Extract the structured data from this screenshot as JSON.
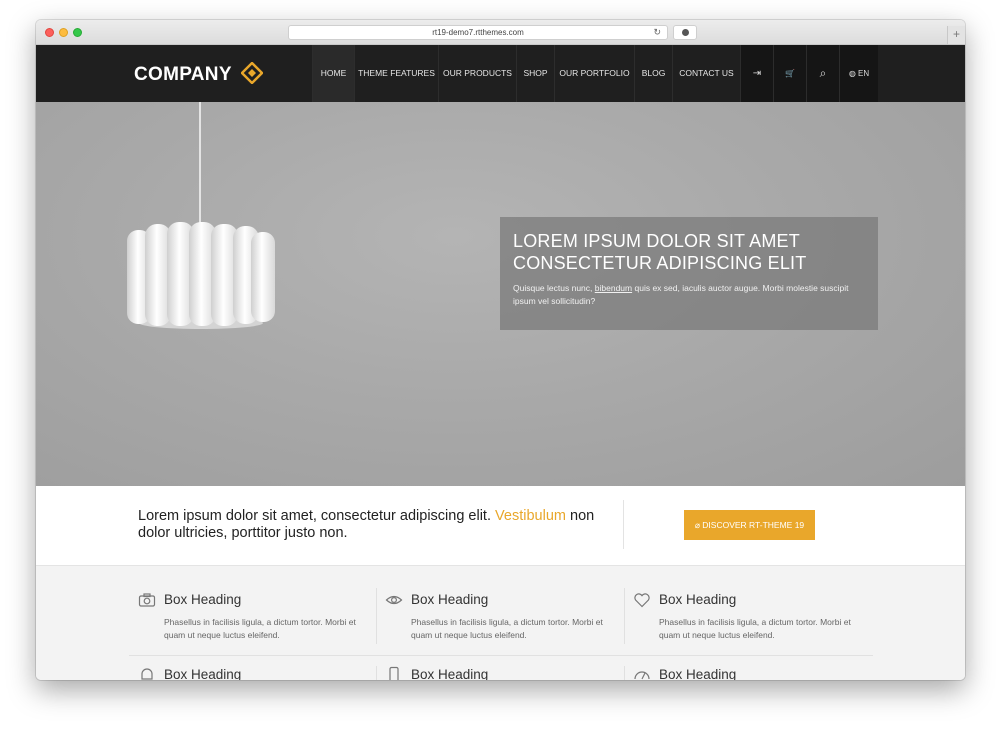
{
  "browser": {
    "url": "rt19-demo7.rtthemes.com",
    "reload_glyph": "↻",
    "newtab_glyph": "+"
  },
  "site": {
    "logo_text": "COMPANY",
    "accent_color": "#e9a72b",
    "nav": [
      {
        "label": "HOME",
        "active": true
      },
      {
        "label": "THEME FEATURES"
      },
      {
        "label": "OUR PRODUCTS"
      },
      {
        "label": "SHOP"
      },
      {
        "label": "OUR PORTFOLIO"
      },
      {
        "label": "BLOG"
      },
      {
        "label": "CONTACT US"
      }
    ],
    "nav_icons": [
      {
        "icon": "login-icon",
        "glyph": "⇥"
      },
      {
        "icon": "cart-icon",
        "glyph": "🛒"
      },
      {
        "icon": "search-icon",
        "glyph": "⌕"
      },
      {
        "icon": "globe-icon",
        "glyph": "◍",
        "label": "EN"
      }
    ]
  },
  "hero": {
    "title_line1": "LOREM IPSUM DOLOR SIT AMET",
    "title_line2": "CONSECTETUR ADIPISCING ELIT",
    "text_before": "Quisque lectus nunc,",
    "text_link": "bibendum",
    "text_after": "quis ex sed, iaculis auctor augue. Morbi molestie suscipit ipsum vel sollicitudin?"
  },
  "cta": {
    "text_main": "Lorem ipsum dolor sit amet, consectetur adipiscing elit.",
    "text_accent": "Vestibulum",
    "text_end": "non dolor ultricies, porttitor justo non.",
    "button_label": "DISCOVER RT-THEME 19"
  },
  "features": [
    {
      "icon": "camera-icon",
      "title": "Box Heading",
      "text": "Phasellus in facilisis ligula, a dictum tortor. Morbi et quam ut neque luctus eleifend."
    },
    {
      "icon": "eye-icon",
      "title": "Box Heading",
      "text": "Phasellus in facilisis ligula, a dictum tortor. Morbi et quam ut neque luctus eleifend."
    },
    {
      "icon": "heart-icon",
      "title": "Box Heading",
      "text": "Phasellus in facilisis ligula, a dictum tortor. Morbi et quam ut neque luctus eleifend."
    },
    {
      "icon": "bell-icon",
      "title": "Box Heading",
      "text": ""
    },
    {
      "icon": "mobile-icon",
      "title": "Box Heading",
      "text": ""
    },
    {
      "icon": "gauge-icon",
      "title": "Box Heading",
      "text": ""
    }
  ]
}
